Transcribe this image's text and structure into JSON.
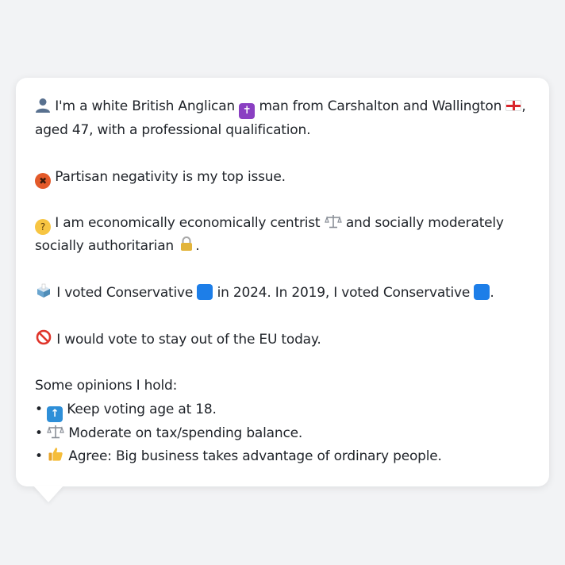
{
  "card": {
    "intro_line1": "I'm a white British Anglican",
    "intro_mid": "man from Carshalton and Wallington",
    "intro_comma": ",",
    "intro_line2": "aged 47, with a professional qualification.",
    "issue": "Partisan negativity is my top issue.",
    "econ_a": "I am economically economically centrist",
    "econ_b": "and socially moderately",
    "econ_c": "socially authoritarian",
    "econ_end": ".",
    "vote_a": "I voted Conservative",
    "vote_b": "in 2024. In 2019, I voted Conservative",
    "vote_end": ".",
    "eu": "I would vote to stay out of the EU today.",
    "opinions_heading": "Some opinions I hold:",
    "bullet": "•",
    "opinions": [
      "Keep voting age at 18.",
      "Moderate on tax/spending balance.",
      "Agree: Big business takes advantage of ordinary people."
    ]
  },
  "icons": {
    "person": "person-icon",
    "cross": "latin-cross-icon",
    "flag": "england-flag-icon",
    "angry": "angry-face-icon",
    "think": "thinking-face-icon",
    "scale": "balance-scale-icon",
    "lock": "lock-icon",
    "ballot": "ballot-box-icon",
    "blue": "blue-square-icon",
    "nope": "prohibited-icon",
    "up": "up-arrow-icon",
    "thumb": "thumbs-up-icon"
  },
  "colors": {
    "conservative_blue": "#1d7ee8",
    "card_bg": "#ffffff",
    "page_bg": "#f2f3f5"
  }
}
